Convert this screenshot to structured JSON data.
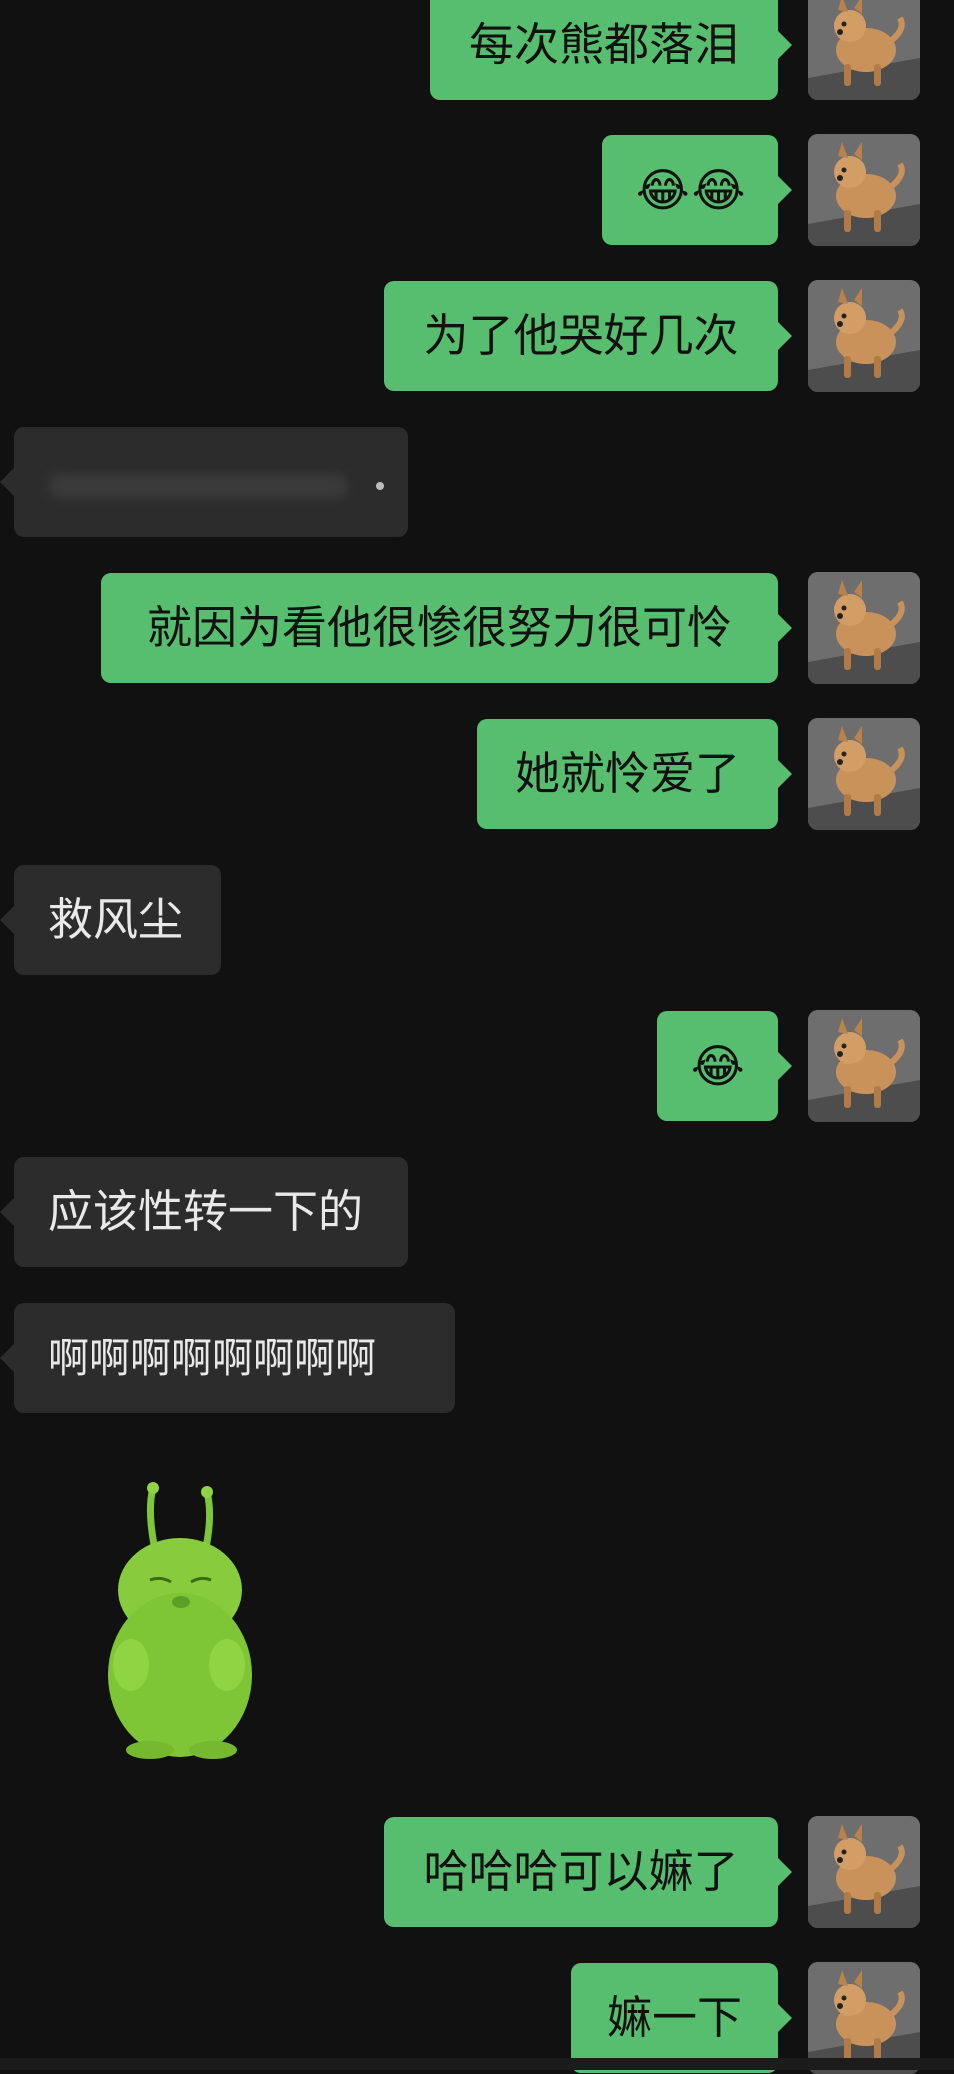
{
  "colors": {
    "background": "#111111",
    "outgoing_bubble": "#57be70",
    "incoming_bubble": "#2c2c2c",
    "outgoing_text": "#111111",
    "incoming_text": "#e9e9e9"
  },
  "messages": [
    {
      "direction": "out",
      "text": "每次熊都落泪",
      "avatar": "dog-avatar"
    },
    {
      "direction": "out",
      "text": "😂😂",
      "avatar": "dog-avatar"
    },
    {
      "direction": "out",
      "text": "为了他哭好几次",
      "avatar": "dog-avatar"
    },
    {
      "direction": "in",
      "text": "",
      "note": "blurred"
    },
    {
      "direction": "out",
      "text": "就因为看他很惨很努力很可怜",
      "avatar": "dog-avatar"
    },
    {
      "direction": "out",
      "text": "她就怜爱了",
      "avatar": "dog-avatar"
    },
    {
      "direction": "in",
      "text": "救风尘"
    },
    {
      "direction": "out",
      "text": "😂",
      "avatar": "dog-avatar"
    },
    {
      "direction": "in",
      "text": "应该性转一下的"
    },
    {
      "direction": "in",
      "text": "啊啊啊啊啊啊啊啊"
    },
    {
      "direction": "in",
      "sticker": "green-alien-cat-sticker"
    },
    {
      "direction": "out",
      "text": "哈哈哈可以嫲了",
      "avatar": "dog-avatar"
    },
    {
      "direction": "out",
      "text": "嫲一下",
      "avatar": "dog-avatar"
    }
  ]
}
